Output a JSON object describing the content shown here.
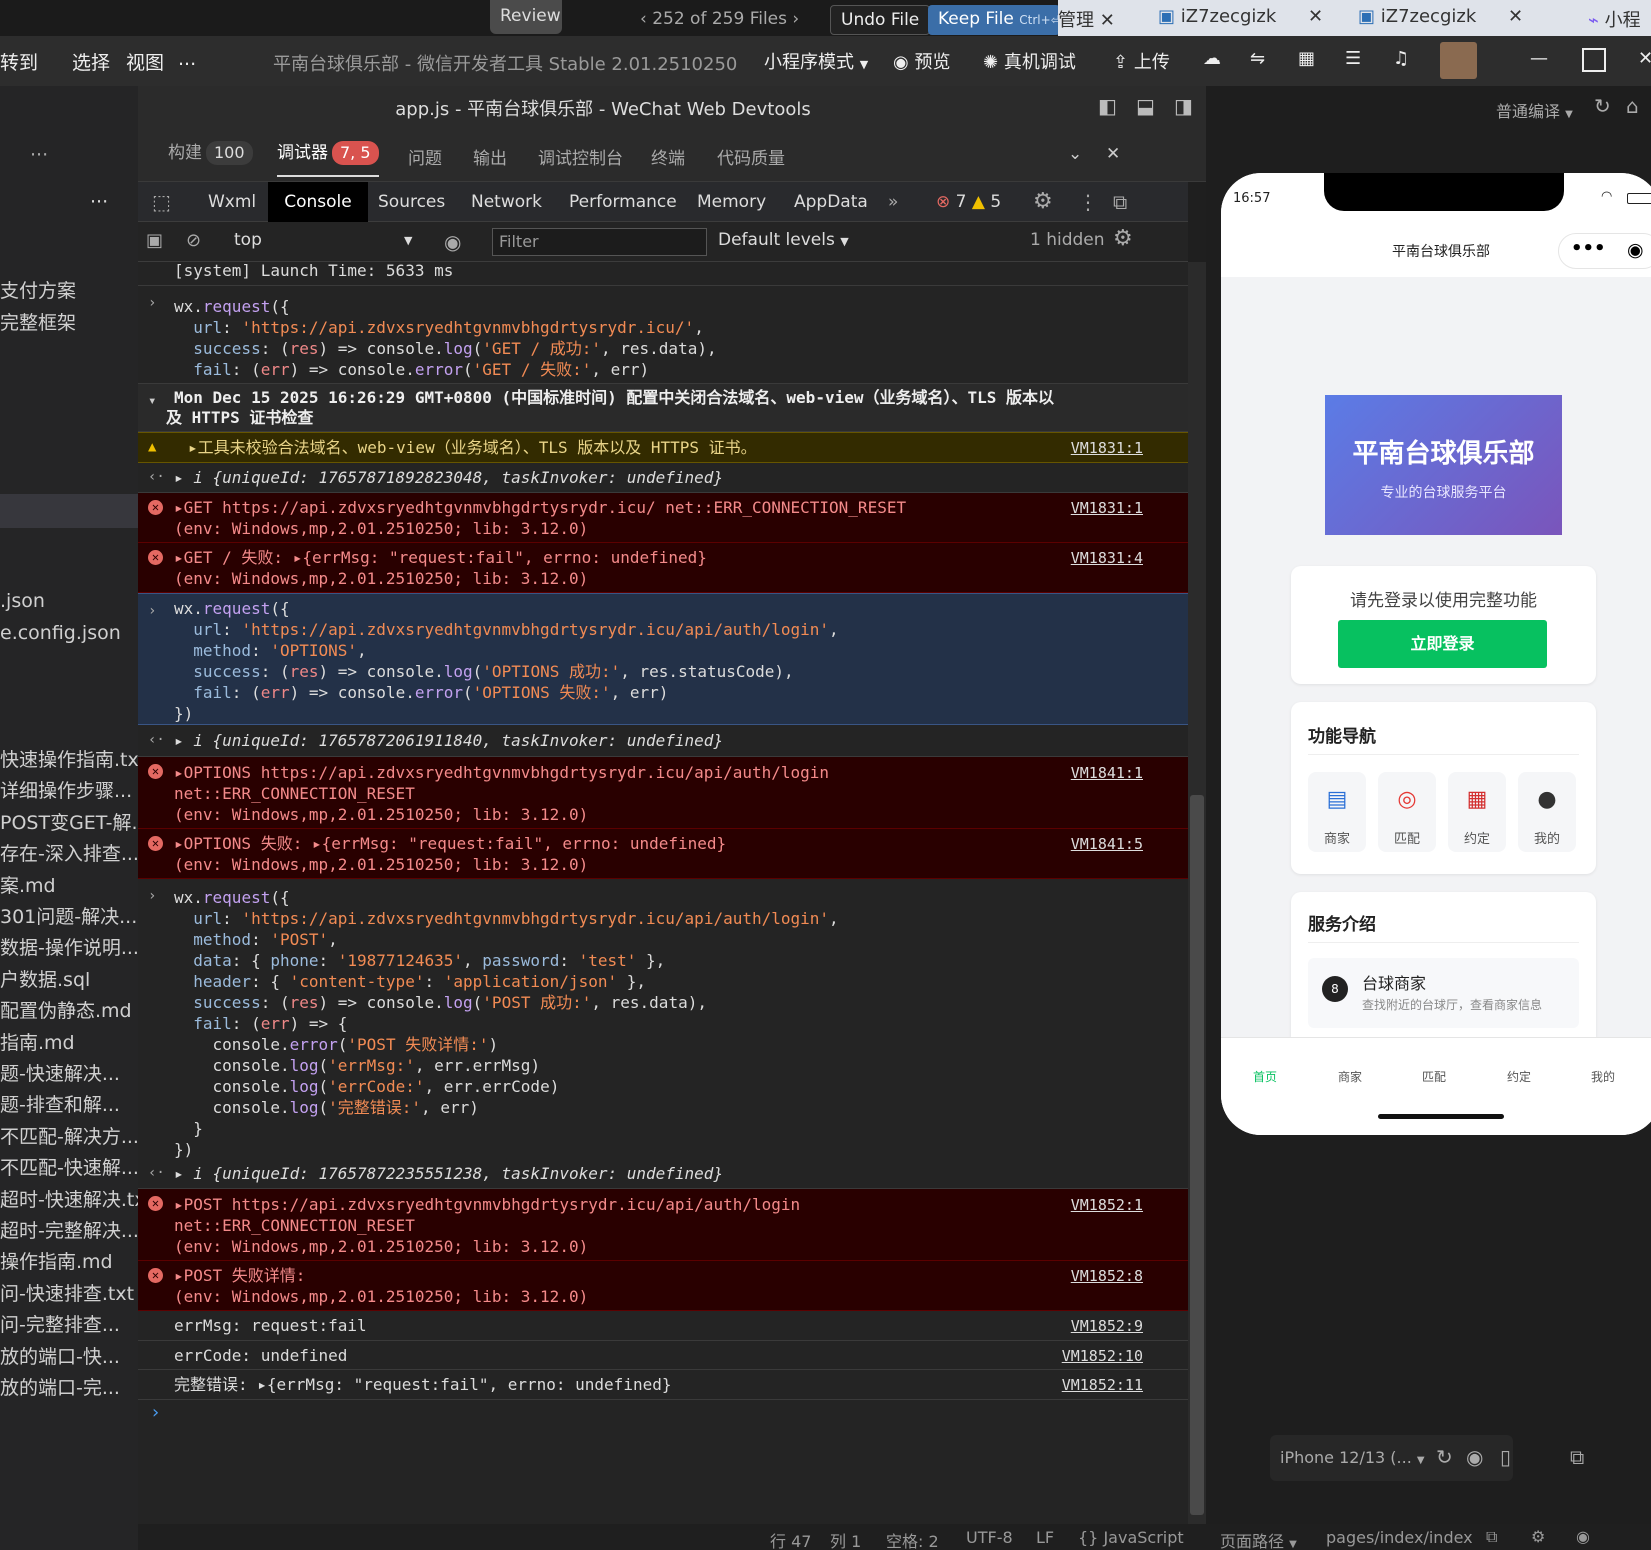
{
  "topstrip": {
    "review": "Review",
    "files_nav": "252 of 259 Files",
    "undo": "Undo File",
    "keep": "Keep File",
    "keep_shortcut": "Ctrl+⏎",
    "browser_tabs": [
      "管理",
      "iZ7zecgizk",
      "iZ7zecgizk",
      "小程"
    ]
  },
  "menubar": {
    "items": [
      "转到",
      "选择",
      "视图",
      "..."
    ],
    "title_app": "平南台球俱乐部",
    "title_tool": " - 微信开发者工具 Stable 2.01.2510250",
    "mode": "小程序模式",
    "preview": "预览",
    "real_debug": "真机调试",
    "upload": "上传"
  },
  "doc_title": "app.js - 平南台球俱乐部 - WeChat Web Devtools",
  "compile": "普通编译",
  "sidebar": {
    "top_items": [
      "支付方案",
      "完整框架"
    ],
    "files": [
      ".json",
      "e.config.json"
    ],
    "lower_files": [
      "快速操作指南.txt",
      "详细操作步骤...",
      "POST变GET-解...",
      "存在-深入排查...",
      "案.md",
      "301问题-解决...",
      "数据-操作说明...",
      "户数据.sql",
      "配置伪静态.md",
      "指南.md",
      "题-快速解决...",
      "题-排查和解...",
      "不匹配-解决方...",
      "不匹配-快速解...",
      "超时-快速解决.txt",
      "超时-完整解决...",
      "操作指南.md",
      "问-快速排查.txt",
      "问-完整排查...",
      "放的端口-快...",
      "放的端口-完..."
    ]
  },
  "panel_tabs": {
    "build": "构建",
    "build_count": "100",
    "debugger": "调试器",
    "debugger_badge": "7, 5",
    "problems": "问题",
    "output": "输出",
    "debug_console": "调试控制台",
    "terminal": "终端",
    "code_quality": "代码质量"
  },
  "devtools_tabs": [
    "Wxml",
    "Console",
    "Sources",
    "Network",
    "Performance",
    "Memory",
    "AppData"
  ],
  "counts": {
    "errors": "7",
    "warnings": "5"
  },
  "filterbar": {
    "context": "top",
    "filter_placeholder": "Filter",
    "levels": "Default levels",
    "hidden": "1 hidden"
  },
  "console": {
    "launch": "[system] Launch Time: 5633 ms",
    "cmd1": [
      "wx.request({",
      "  url: 'https://api.zdvxsryedhtgvnmvbhgdrtysrydr.icu/',",
      "  success: (res) => console.log('GET / 成功:', res.data),",
      "  fail: (err) => console.error('GET / 失败:', err)",
      "})"
    ],
    "group_header": "Mon Dec 15 2025 16:26:29 GMT+0800 (中国标准时间) 配置中关闭合法域名、web-view（业务域名）、TLS 版本以",
    "group_header2": "及 HTTPS 证书检查",
    "warn1": "▸工具未校验合法域名、web-view（业务域名）、TLS 版本以及 HTTPS 证书。",
    "warn1_src": "VM1831:1",
    "ret1": "▸ i {uniqueId: 17657871892823048, taskInvoker: undefined}",
    "err1a": "▸GET https://api.zdvxsryedhtgvnmvbhgdrtysrydr.icu/ net::ERR_CONNECTION_RESET",
    "err1b": "(env: Windows,mp,2.01.2510250; lib: 3.12.0)",
    "err1_src": "VM1831:1",
    "err2a": "▸GET / 失败: ▸{errMsg: \"request:fail\", errno: undefined}",
    "err2b": "(env: Windows,mp,2.01.2510250; lib: 3.12.0)",
    "err2_src": "VM1831:4",
    "cmd2": [
      "wx.request({",
      "  url: 'https://api.zdvxsryedhtgvnmvbhgdrtysrydr.icu/api/auth/login',",
      "  method: 'OPTIONS',",
      "  success: (res) => console.log('OPTIONS 成功:', res.statusCode),",
      "  fail: (err) => console.error('OPTIONS 失败:', err)",
      "})"
    ],
    "ret2": "▸ i {uniqueId: 17657872061911840, taskInvoker: undefined}",
    "err3a": "▸OPTIONS https://api.zdvxsryedhtgvnmvbhgdrtysrydr.icu/api/auth/login",
    "err3b": "net::ERR_CONNECTION_RESET",
    "err3c": "(env: Windows,mp,2.01.2510250; lib: 3.12.0)",
    "err3_src": "VM1841:1",
    "err4a": "▸OPTIONS 失败: ▸{errMsg: \"request:fail\", errno: undefined}",
    "err4b": "(env: Windows,mp,2.01.2510250; lib: 3.12.0)",
    "err4_src": "VM1841:5",
    "cmd3": [
      "wx.request({",
      "  url: 'https://api.zdvxsryedhtgvnmvbhgdrtysrydr.icu/api/auth/login',",
      "  method: 'POST',",
      "  data: { phone: '19877124635', password: 'test' },",
      "  header: { 'content-type': 'application/json' },",
      "  success: (res) => console.log('POST 成功:', res.data),",
      "  fail: (err) => {",
      "    console.error('POST 失败详情:')",
      "    console.log('errMsg:', err.errMsg)",
      "    console.log('errCode:', err.errCode)",
      "    console.log('完整错误:', err)",
      "  }",
      "})"
    ],
    "ret3": "▸ i {uniqueId: 17657872235551238, taskInvoker: undefined}",
    "err5a": "▸POST https://api.zdvxsryedhtgvnmvbhgdrtysrydr.icu/api/auth/login",
    "err5b": "net::ERR_CONNECTION_RESET",
    "err5c": "(env: Windows,mp,2.01.2510250; lib: 3.12.0)",
    "err5_src": "VM1852:1",
    "err6a": "▸POST 失败详情:",
    "err6b": "(env: Windows,mp,2.01.2510250; lib: 3.12.0)",
    "err6_src": "VM1852:8",
    "log1": "errMsg: request:fail",
    "log1_src": "VM1852:9",
    "log2": "errCode: undefined",
    "log2_src": "VM1852:10",
    "log3": "完整错误: ▸{errMsg: \"request:fail\", errno: undefined}",
    "log3_src": "VM1852:11"
  },
  "statusbar": {
    "line": "行 47",
    "col": "列 1",
    "spaces": "空格: 2",
    "enc": "UTF-8",
    "eol": "LF",
    "lang": "JavaScript"
  },
  "phone": {
    "time": "16:57",
    "nav_title": "平南台球俱乐部",
    "banner_title": "平南台球俱乐部",
    "banner_sub": "专业的台球服务平台",
    "login_prompt": "请先登录以使用完整功能",
    "login_btn": "立即登录",
    "features_title": "功能导航",
    "features": [
      "商家",
      "匹配",
      "约定",
      "我的"
    ],
    "service_title": "服务介绍",
    "service_item_title": "台球商家",
    "service_item_desc": "查找附近的台球厅，查看商家信息",
    "tabbar": [
      "首页",
      "商家",
      "匹配",
      "约定",
      "我的"
    ],
    "accent": "#07c160"
  },
  "simulator": {
    "device": "iPhone 12/13 (...",
    "page_path_label": "页面路径",
    "page_path": "pages/index/index"
  }
}
